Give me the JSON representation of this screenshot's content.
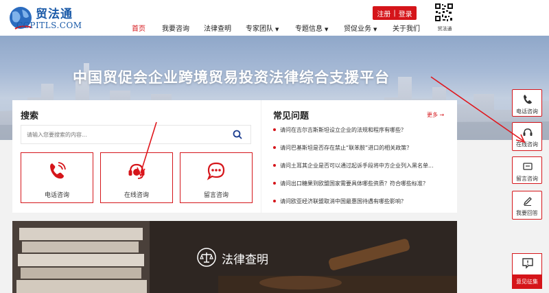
{
  "logo": {
    "cn": "贸法通",
    "en": "CCPITLS.COM"
  },
  "nav": [
    {
      "label": "首页",
      "active": true,
      "dropdown": false
    },
    {
      "label": "我要咨询",
      "active": false,
      "dropdown": false
    },
    {
      "label": "法律查明",
      "active": false,
      "dropdown": false
    },
    {
      "label": "专家团队",
      "active": false,
      "dropdown": true
    },
    {
      "label": "专题信息",
      "active": false,
      "dropdown": true
    },
    {
      "label": "贸促业务",
      "active": false,
      "dropdown": true
    },
    {
      "label": "关于我们",
      "active": false,
      "dropdown": false
    }
  ],
  "auth": {
    "register": "注册",
    "sep": "|",
    "login": "登录"
  },
  "qr": {
    "label": "贸法通"
  },
  "hero": {
    "title": "中国贸促会企业跨境贸易投资法律综合支援平台"
  },
  "search": {
    "title": "搜索",
    "placeholder": "请输入您要搜索的内容..."
  },
  "cards": [
    {
      "label": "电话咨询",
      "icon": "phone-icon"
    },
    {
      "label": "在线咨询",
      "icon": "headset-icon"
    },
    {
      "label": "留言咨询",
      "icon": "chat-icon"
    }
  ],
  "faq": {
    "title": "常见问题",
    "more": "更多 →",
    "items": [
      "请问在吉尔吉斯斯坦设立企业的法规和程序有哪些？",
      "请问巴基斯坦是否存在禁止“联苯胺”进口的相关政策？",
      "请问土耳其企业是否可以通过起诉手段将中方企业列入黑名单...",
      "请问出口糖果到欧盟国家需要具体哪些资质？符合哪些标准？",
      "请问欧亚经济联盟取消中国最惠国待遇有哪些影响？"
    ]
  },
  "law": {
    "title": "法律查明"
  },
  "side": [
    {
      "label": "电话咨询",
      "icon": "phone-icon"
    },
    {
      "label": "在线咨询",
      "icon": "headset-icon"
    },
    {
      "label": "留言咨询",
      "icon": "message-icon"
    },
    {
      "label": "我要回答",
      "icon": "pen-icon"
    }
  ],
  "feedback": {
    "label": "意见征集",
    "icon": "feedback-icon"
  },
  "colors": {
    "accent": "#d5151a",
    "brand": "#1a5aa8"
  }
}
